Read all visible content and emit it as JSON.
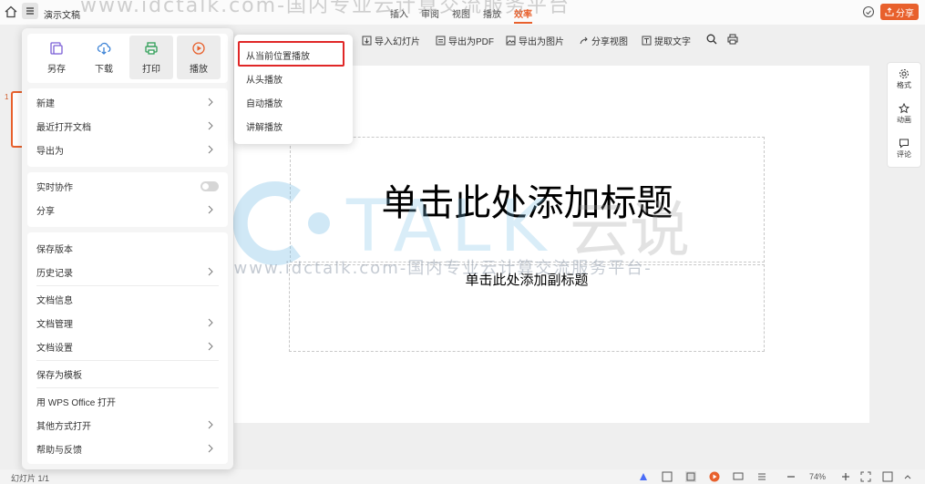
{
  "titlebar": {
    "doc_name": "演示文稿",
    "tabs": [
      "插入",
      "审阅",
      "视图",
      "播放",
      "效率"
    ],
    "active_tab": "效率",
    "share_label": "分享",
    "accent": "#e8602c"
  },
  "toolbar": {
    "items": [
      "导入幻灯片",
      "导出为PDF",
      "导出为图片",
      "分享视图",
      "提取文字"
    ]
  },
  "menu": {
    "quick_actions": [
      "另存",
      "下载",
      "打印",
      "播放"
    ],
    "group1": [
      "新建",
      "最近打开文档",
      "导出为"
    ],
    "group2": [
      "实时协作",
      "分享"
    ],
    "group3": [
      "保存版本",
      "历史记录",
      "文档信息",
      "文档管理",
      "文档设置",
      "保存为模板",
      "用 WPS Office 打开",
      "其他方式打开",
      "帮助与反馈"
    ]
  },
  "submenu": {
    "items": [
      "从当前位置播放",
      "从头播放",
      "自动播放",
      "讲解播放"
    ],
    "highlight_color": "#e02727"
  },
  "slide": {
    "thumb_number": "1",
    "title_placeholder": "单击此处添加标题",
    "subtitle_placeholder": "单击此处添加副标题"
  },
  "watermark": {
    "brand": "TALK 云说",
    "url_line": "-www.idctalk.com-国内专业云计算交流服务平台-",
    "top_line": "www.idctalk.com-国内专业云计算交流服务平台"
  },
  "right_panel": [
    "格式",
    "动画",
    "评论"
  ],
  "statusbar": {
    "slide_count": "幻灯片 1/1",
    "zoom": "74%"
  }
}
